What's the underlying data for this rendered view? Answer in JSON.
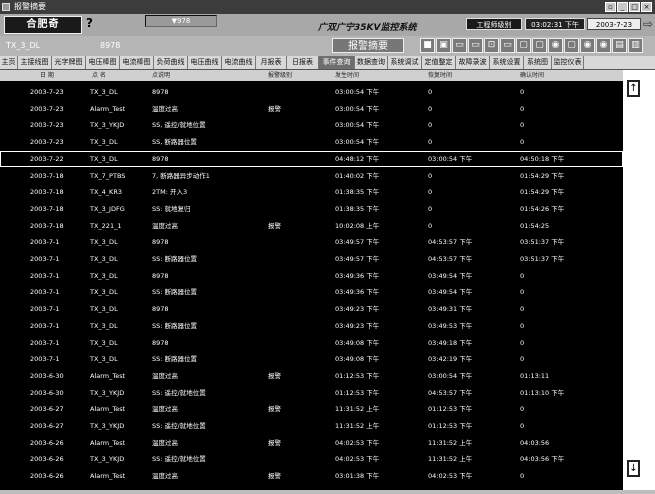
{
  "window": {
    "title": "报警摘要",
    "buttons": [
      "▫",
      "_",
      "□",
      "×"
    ]
  },
  "header": {
    "logo_text": "合肥奇",
    "help": "?",
    "top_value": "▼978",
    "system_name": "广双广宁35KV监控系统",
    "engineer_button": "工程师级别",
    "clock": "03:02:31 下午",
    "date": "2003-7-23",
    "forward_arrow": "⇨"
  },
  "selection": {
    "name": "TX_3_DL",
    "code": "8978"
  },
  "alarm_summary_button": "报警摘要",
  "toolbar_icons": [
    "■",
    "▣",
    "▭",
    "▭",
    "⊡",
    "▭",
    "▢",
    "▢",
    "◉",
    "▢",
    "◉",
    "◉",
    "▤",
    "▥"
  ],
  "menu": [
    "主页",
    "主接线图",
    "光字牌图",
    "电压棒图",
    "电流棒图",
    "负荷曲线",
    "电压曲线",
    "电流曲线",
    "月报表",
    "日报表",
    "事件查询",
    "数据查询",
    "系统调试",
    "定值整定",
    "故障录波",
    "系统设置",
    "系统图",
    "监控仪表"
  ],
  "active_menu_index": 10,
  "table": {
    "headers": [
      "日 期",
      "点 名",
      "点说明",
      "报警级别",
      "发生时间",
      "恢复时间",
      "确认时间"
    ],
    "rows": [
      [
        "2003-7-23",
        "TX_3_DL",
        "8978",
        "",
        "03:00:54 下午",
        "0",
        "0"
      ],
      [
        "2003-7-23",
        "Alarm_Test",
        "温度过高",
        "报警",
        "03:00:54 下午",
        "0",
        "0"
      ],
      [
        "2003-7-23",
        "TX_3_YKJD",
        "SS, 遥控/就地位置",
        "",
        "03:00:54 下午",
        "0",
        "0"
      ],
      [
        "2003-7-23",
        "TX_3_DL",
        "SS, 断路器位置",
        "",
        "03:00:54 下午",
        "0",
        "0"
      ],
      [
        "2003-7-22",
        "TX_3_DL",
        "8978",
        "",
        "04:48:12 下午",
        "03:00:54 下午",
        "04:50:18 下午"
      ],
      [
        "2003-7-18",
        "TX_7_PTBS",
        "7, 断路器异步动作1",
        "",
        "01:40:02 下午",
        "0",
        "01:54:29 下午"
      ],
      [
        "2003-7-18",
        "TX_4_KR3",
        "2TM: 开入3",
        "",
        "01:38:35 下午",
        "0",
        "01:54:29 下午"
      ],
      [
        "2003-7-18",
        "TX_3_JDFG",
        "SS: 就地复归",
        "",
        "01:38:35 下午",
        "0",
        "01:54:26 下午"
      ],
      [
        "2003-7-18",
        "TX_221_1",
        "温度过高",
        "报警",
        "10:02:08 上午",
        "0",
        "01:54:25"
      ],
      [
        "2003-7-1",
        "TX_3_DL",
        "8978",
        "",
        "03:49:57 下午",
        "04:53:57 下午",
        "03:51:37 下午"
      ],
      [
        "2003-7-1",
        "TX_3_DL",
        "SS: 断路器位置",
        "",
        "03:49:57 下午",
        "04:53:57 下午",
        "03:51:37 下午"
      ],
      [
        "2003-7-1",
        "TX_3_DL",
        "8978",
        "",
        "03:49:36 下午",
        "03:49:54 下午",
        "0"
      ],
      [
        "2003-7-1",
        "TX_3_DL",
        "SS: 断路器位置",
        "",
        "03:49:36 下午",
        "03:49:54 下午",
        "0"
      ],
      [
        "2003-7-1",
        "TX_3_DL",
        "8978",
        "",
        "03:49:23 下午",
        "03:49:31 下午",
        "0"
      ],
      [
        "2003-7-1",
        "TX_3_DL",
        "SS: 断路器位置",
        "",
        "03:49:23 下午",
        "03:49:53 下午",
        "0"
      ],
      [
        "2003-7-1",
        "TX_3_DL",
        "8978",
        "",
        "03:49:08 下午",
        "03:49:18 下午",
        "0"
      ],
      [
        "2003-7-1",
        "TX_3_DL",
        "SS: 断路器位置",
        "",
        "03:49:08 下午",
        "03:42:19 下午",
        "0"
      ],
      [
        "2003-6-30",
        "Alarm_Test",
        "温度过高",
        "报警",
        "01:12:53 下午",
        "03:00:54 下午",
        "01:13:11"
      ],
      [
        "2003-6-30",
        "TX_3_YKJD",
        "SS: 遥控/就地位置",
        "",
        "01:12:53 下午",
        "04:53:57 下午",
        "01:13:10 下午"
      ],
      [
        "2003-6-27",
        "Alarm_Test",
        "温度过高",
        "报警",
        "11:31:52 上午",
        "01:12:53 下午",
        "0"
      ],
      [
        "2003-6-27",
        "TX_3_YKJD",
        "SS: 遥控/就地位置",
        "",
        "11:31:52 上午",
        "01:12:53 下午",
        "0"
      ],
      [
        "2003-6-26",
        "Alarm_Test",
        "温度过高",
        "报警",
        "04:02:53 下午",
        "11:31:52 上午",
        "04:03:56"
      ],
      [
        "2003-6-26",
        "TX_3_YKJD",
        "SS: 遥控/就地位置",
        "",
        "04:02:53 下午",
        "11:31:52 上午",
        "04:03:56 下午"
      ],
      [
        "2003-6-26",
        "Alarm_Test",
        "温度过高",
        "报警",
        "03:01:38 下午",
        "04:02:53 下午",
        "0"
      ]
    ],
    "selected_row_index": 4
  },
  "scrollbar": {
    "up": "↑",
    "down": "↓"
  }
}
